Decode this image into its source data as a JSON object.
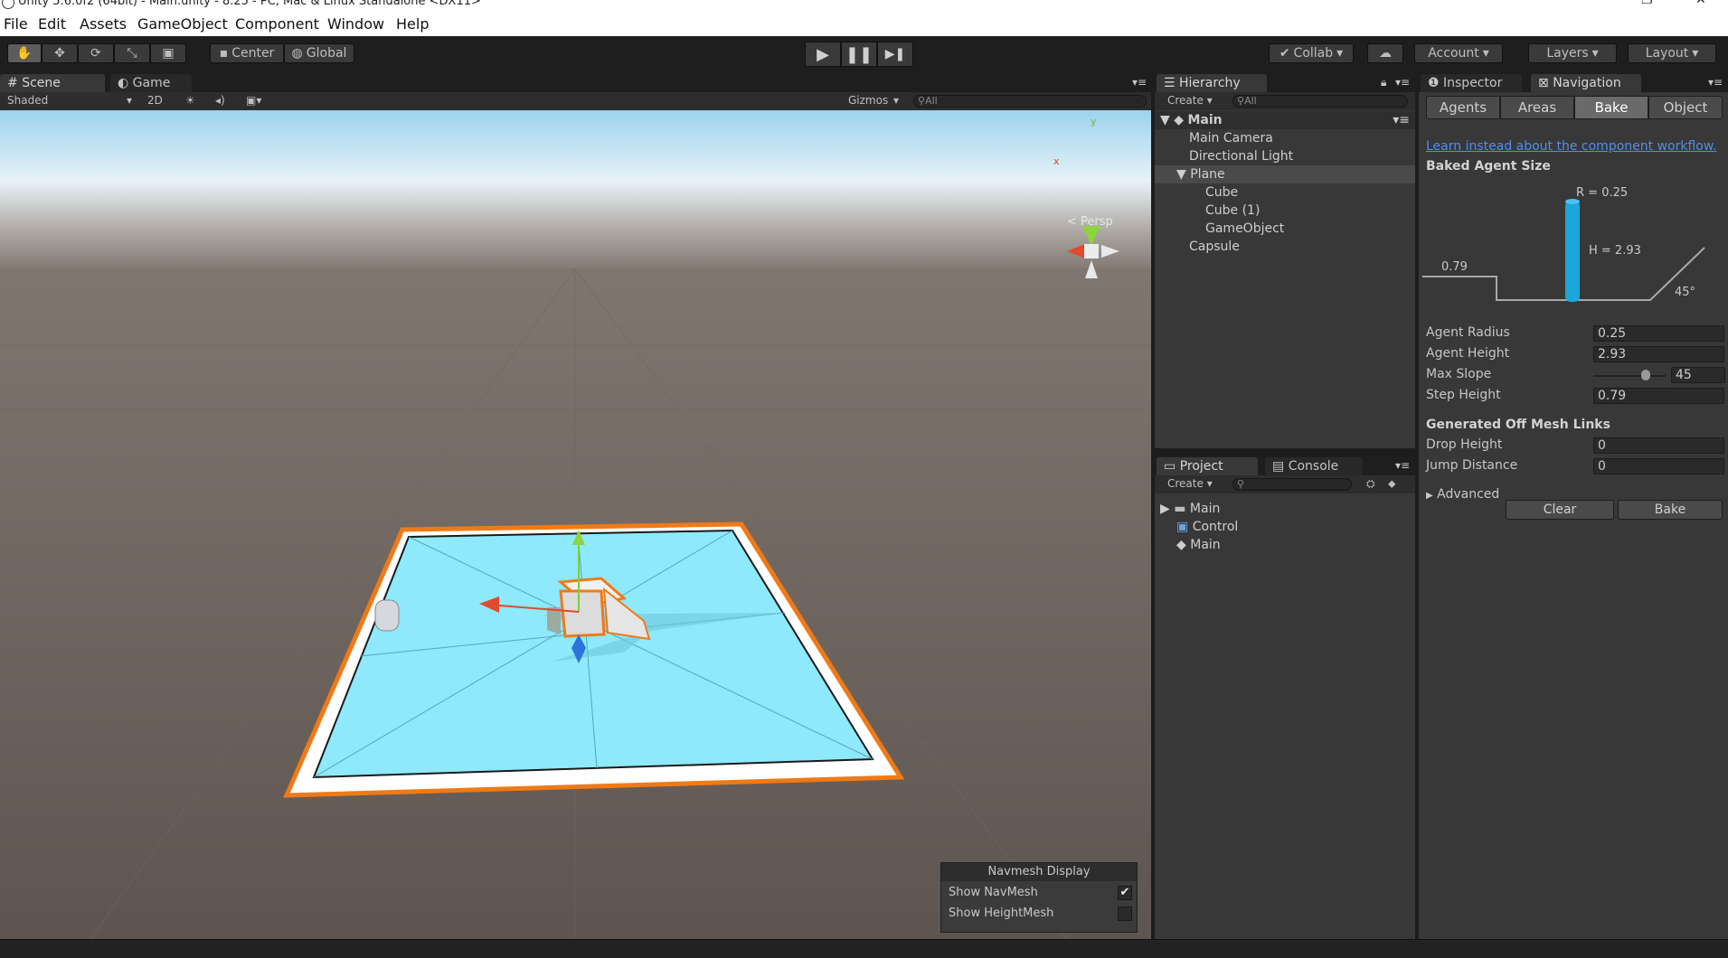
{
  "window": {
    "title": "Unity 5.6.0f2 (64bit) - Main.unity - 8.25 - PC, Mac & Linux Standalone <DX11>",
    "restore_glyph": "❐",
    "close_glyph": "✕"
  },
  "menu": [
    "File",
    "Edit",
    "Assets",
    "GameObject",
    "Component",
    "Window",
    "Help"
  ],
  "toolbar": {
    "tools": [
      "hand-icon",
      "move-icon",
      "rotate-icon",
      "scale-icon",
      "rect-icon"
    ],
    "tool_glyphs": [
      "✋",
      "✥",
      "⟳",
      "⤡",
      "▣"
    ],
    "pivot": "Center",
    "space": "Global",
    "play_glyphs": [
      "▶",
      "❚❚",
      "▶❚"
    ],
    "collab": "Collab",
    "account": "Account",
    "layers": "Layers",
    "layout": "Layout"
  },
  "scene": {
    "tabs": [
      "Scene",
      "Game"
    ],
    "shading": "Shaded",
    "mode2d": "2D",
    "gizmos": "Gizmos",
    "search_placeholder": "All",
    "persp": "Persp",
    "axis_y": "y",
    "axis_x": "x",
    "navmesh_display": {
      "title": "Navmesh Display",
      "show_navmesh": "Show NavMesh",
      "show_navmesh_checked": true,
      "show_heightmesh": "Show HeightMesh",
      "show_heightmesh_checked": false
    }
  },
  "hierarchy": {
    "tab": "Hierarchy",
    "create": "Create",
    "search_placeholder": "All",
    "scene_name": "Main",
    "items": [
      "Main Camera",
      "Directional Light",
      "Plane",
      "Cube",
      "Cube (1)",
      "GameObject",
      "Capsule"
    ]
  },
  "project": {
    "tabs": [
      "Project",
      "Console"
    ],
    "create": "Create",
    "items": [
      "Main",
      "Control",
      "Main"
    ]
  },
  "inspector": {
    "tabs": [
      "Inspector",
      "Navigation"
    ],
    "nav_tabs": [
      "Agents",
      "Areas",
      "Bake",
      "Object"
    ],
    "selected_nav_tab": "Bake",
    "link": "Learn instead about the component workflow.",
    "baked_agent_size": "Baked Agent Size",
    "diagram": {
      "r": "R = 0.25",
      "h": "H = 2.93",
      "step": "0.79",
      "slope": "45°"
    },
    "fields": [
      {
        "label": "Agent Radius",
        "value": "0.25"
      },
      {
        "label": "Agent Height",
        "value": "2.93"
      },
      {
        "label": "Max Slope",
        "value": "45"
      },
      {
        "label": "Step Height",
        "value": "0.79"
      }
    ],
    "max_slope_fraction": 0.75,
    "offmesh_title": "Generated Off Mesh Links",
    "offmesh_fields": [
      {
        "label": "Drop Height",
        "value": "0"
      },
      {
        "label": "Jump Distance",
        "value": "0"
      }
    ],
    "advanced": "Advanced",
    "clear": "Clear",
    "bake": "Bake"
  },
  "colors": {
    "accent_orange": "#f07a16",
    "navmesh_cyan": "#8ee9fb",
    "link_blue": "#4d8fe8",
    "agent_cyan": "#1ba7dc"
  }
}
